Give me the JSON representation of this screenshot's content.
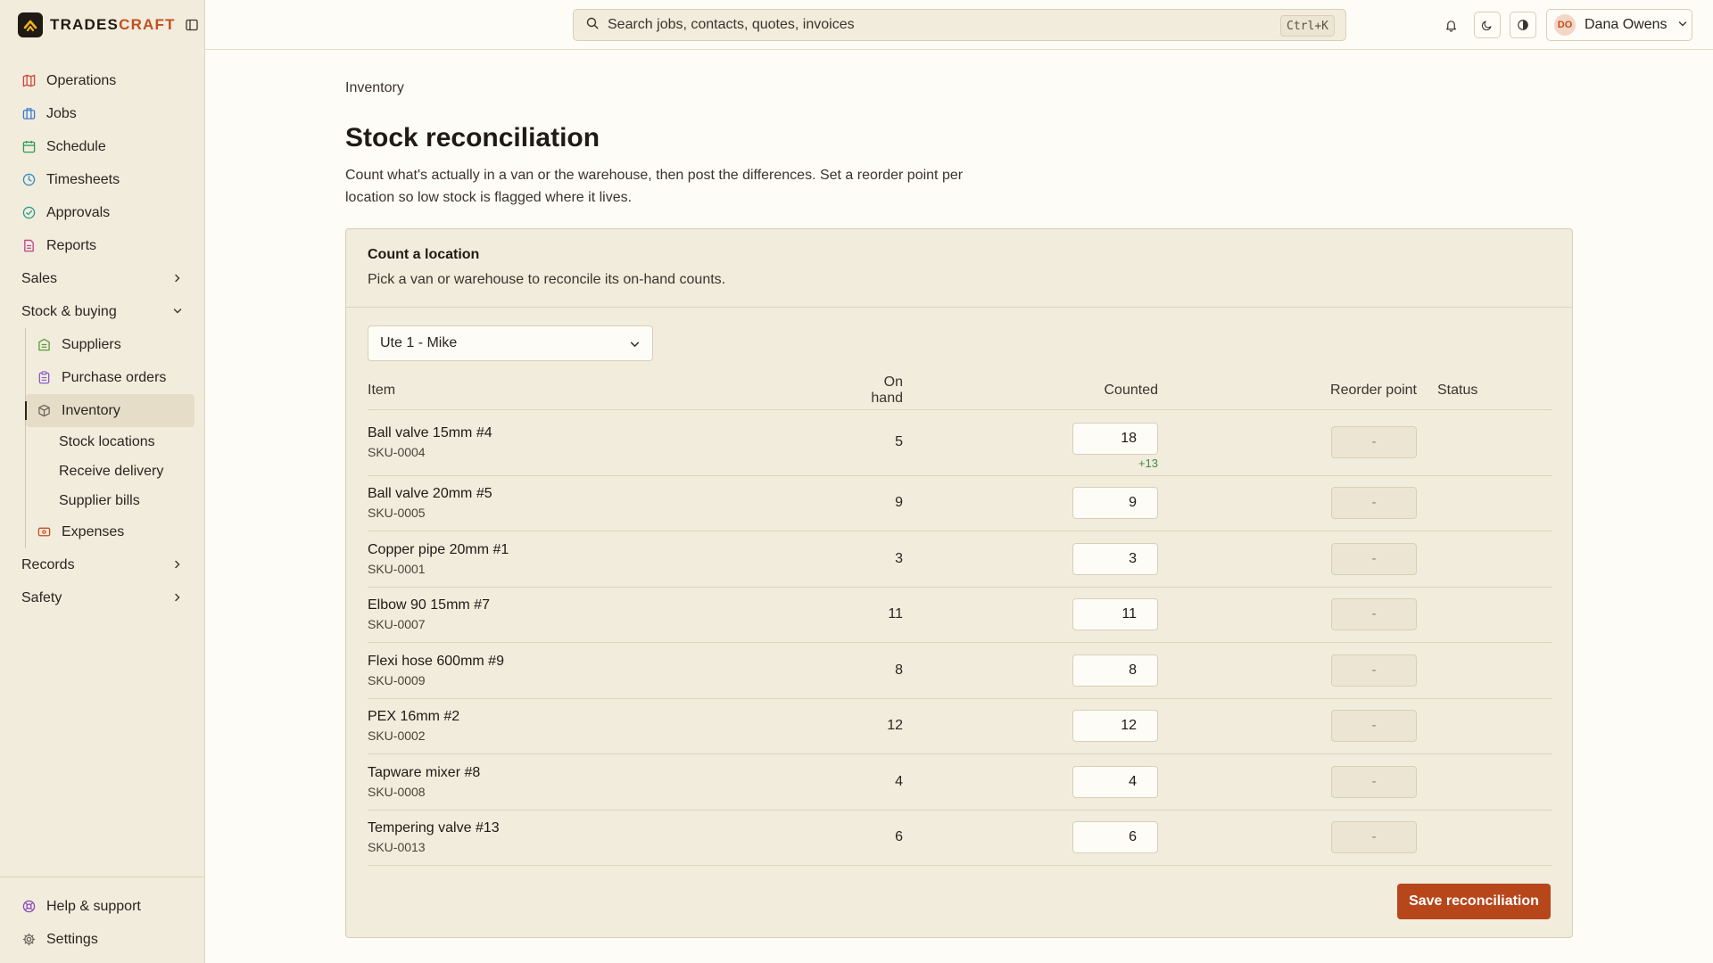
{
  "app": {
    "brand_main": "TRADES",
    "brand_accent": "CRAFT"
  },
  "sidebar": {
    "items": [
      {
        "label": "Operations",
        "icon": "map-icon",
        "color": "#d0473a"
      },
      {
        "label": "Jobs",
        "icon": "briefcase-icon",
        "color": "#3d7bd0"
      },
      {
        "label": "Schedule",
        "icon": "calendar-icon",
        "color": "#2e9a57"
      },
      {
        "label": "Timesheets",
        "icon": "clock-icon",
        "color": "#2a8fb8"
      },
      {
        "label": "Approvals",
        "icon": "check-circle-icon",
        "color": "#2a9a8a"
      },
      {
        "label": "Reports",
        "icon": "file-icon",
        "color": "#c2408a"
      }
    ],
    "groups": {
      "sales": "Sales",
      "stock": "Stock & buying",
      "records": "Records",
      "safety": "Safety"
    },
    "stock_items": [
      {
        "label": "Suppliers",
        "icon": "building-icon",
        "color": "#5a9a3a"
      },
      {
        "label": "Purchase orders",
        "icon": "clipboard-icon",
        "color": "#8a5ac8"
      },
      {
        "label": "Inventory",
        "icon": "box-icon",
        "color": "#6a6258"
      }
    ],
    "inventory_children": [
      "Stock locations",
      "Receive delivery",
      "Supplier bills"
    ],
    "expenses": {
      "label": "Expenses",
      "icon": "card-icon",
      "color": "#c2501f"
    },
    "bottom": [
      {
        "label": "Help & support",
        "icon": "lifebuoy-icon",
        "color": "#8a4ab8"
      },
      {
        "label": "Settings",
        "icon": "gear-icon",
        "color": "#6a6258"
      }
    ]
  },
  "topbar": {
    "search_placeholder": "Search jobs, contacts, quotes, invoices",
    "search_shortcut": "Ctrl+K",
    "user_initials": "DO",
    "user_name": "Dana Owens"
  },
  "page": {
    "breadcrumb": "Inventory",
    "title": "Stock reconciliation",
    "description": "Count what's actually in a van or the warehouse, then post the differences. Set a reorder point per location so low stock is flagged where it lives."
  },
  "card": {
    "title": "Count a location",
    "subtitle": "Pick a van or warehouse to reconcile its on-hand counts.",
    "location_selected": "Ute 1 - Mike",
    "columns": {
      "item": "Item",
      "on_hand": "On hand",
      "counted": "Counted",
      "reorder": "Reorder point",
      "status": "Status"
    },
    "rows": [
      {
        "name": "Ball valve 15mm #4",
        "sku": "SKU-0004",
        "on_hand": "5",
        "counted": "18",
        "diff": "+13",
        "reorder": "-"
      },
      {
        "name": "Ball valve 20mm #5",
        "sku": "SKU-0005",
        "on_hand": "9",
        "counted": "9",
        "diff": "",
        "reorder": "-"
      },
      {
        "name": "Copper pipe 20mm #1",
        "sku": "SKU-0001",
        "on_hand": "3",
        "counted": "3",
        "diff": "",
        "reorder": "-"
      },
      {
        "name": "Elbow 90 15mm #7",
        "sku": "SKU-0007",
        "on_hand": "11",
        "counted": "11",
        "diff": "",
        "reorder": "-"
      },
      {
        "name": "Flexi hose 600mm #9",
        "sku": "SKU-0009",
        "on_hand": "8",
        "counted": "8",
        "diff": "",
        "reorder": "-"
      },
      {
        "name": "PEX 16mm #2",
        "sku": "SKU-0002",
        "on_hand": "12",
        "counted": "12",
        "diff": "",
        "reorder": "-"
      },
      {
        "name": "Tapware mixer #8",
        "sku": "SKU-0008",
        "on_hand": "4",
        "counted": "4",
        "diff": "",
        "reorder": "-"
      },
      {
        "name": "Tempering valve #13",
        "sku": "SKU-0013",
        "on_hand": "6",
        "counted": "6",
        "diff": "",
        "reorder": "-"
      }
    ],
    "save_label": "Save reconciliation"
  }
}
